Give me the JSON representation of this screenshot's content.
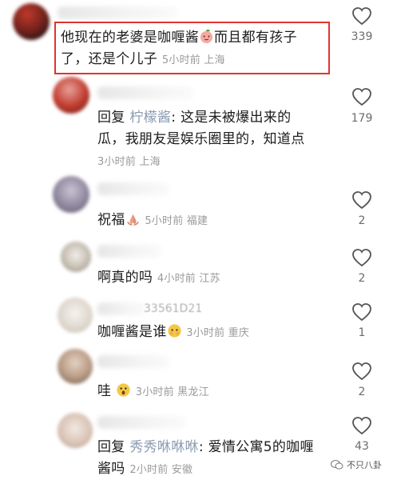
{
  "comments": [
    {
      "name": "",
      "text": "他现在的老婆是咖喱酱",
      "text_after_emoji": "而且都有孩子",
      "text_line2": "了，还是个儿子",
      "time": "5小时前",
      "location": "上海",
      "likes": "339",
      "emoji": "peach-face-emoji"
    },
    {
      "reply_prefix": "回复",
      "reply_to": "柠檬酱",
      "text": "这是未被爆出来的",
      "text_line2": "瓜，我朋友是娱乐圈里的，知道点",
      "time": "3小时前",
      "location": "上海",
      "likes": "179"
    },
    {
      "text": "祝福",
      "time": "5小时前",
      "location": "福建",
      "likes": "2",
      "emoji": "praying-hands-emoji"
    },
    {
      "text": "啊真的吗",
      "time": "4小时前",
      "location": "江苏",
      "likes": "2"
    },
    {
      "name": "33561D21",
      "text": "咖喱酱是谁",
      "time": "3小时前",
      "location": "重庆",
      "likes": "1",
      "emoji": "peeking-face-emoji"
    },
    {
      "text": "哇",
      "time": "3小时前",
      "location": "黑龙江",
      "likes": "2",
      "emoji": "surprised-face-emoji"
    },
    {
      "reply_prefix": "回复",
      "reply_to": "秀秀咻咻咻",
      "text": "爱情公寓5的咖喱",
      "text_line2": "酱吗",
      "time": "2小时前",
      "location": "安徽",
      "likes": "43"
    }
  ],
  "watermark": "不只八卦",
  "colors": {
    "highlight": "#e0332f",
    "meta": "#9a9a9a",
    "reply_to": "#8a9bb0"
  }
}
